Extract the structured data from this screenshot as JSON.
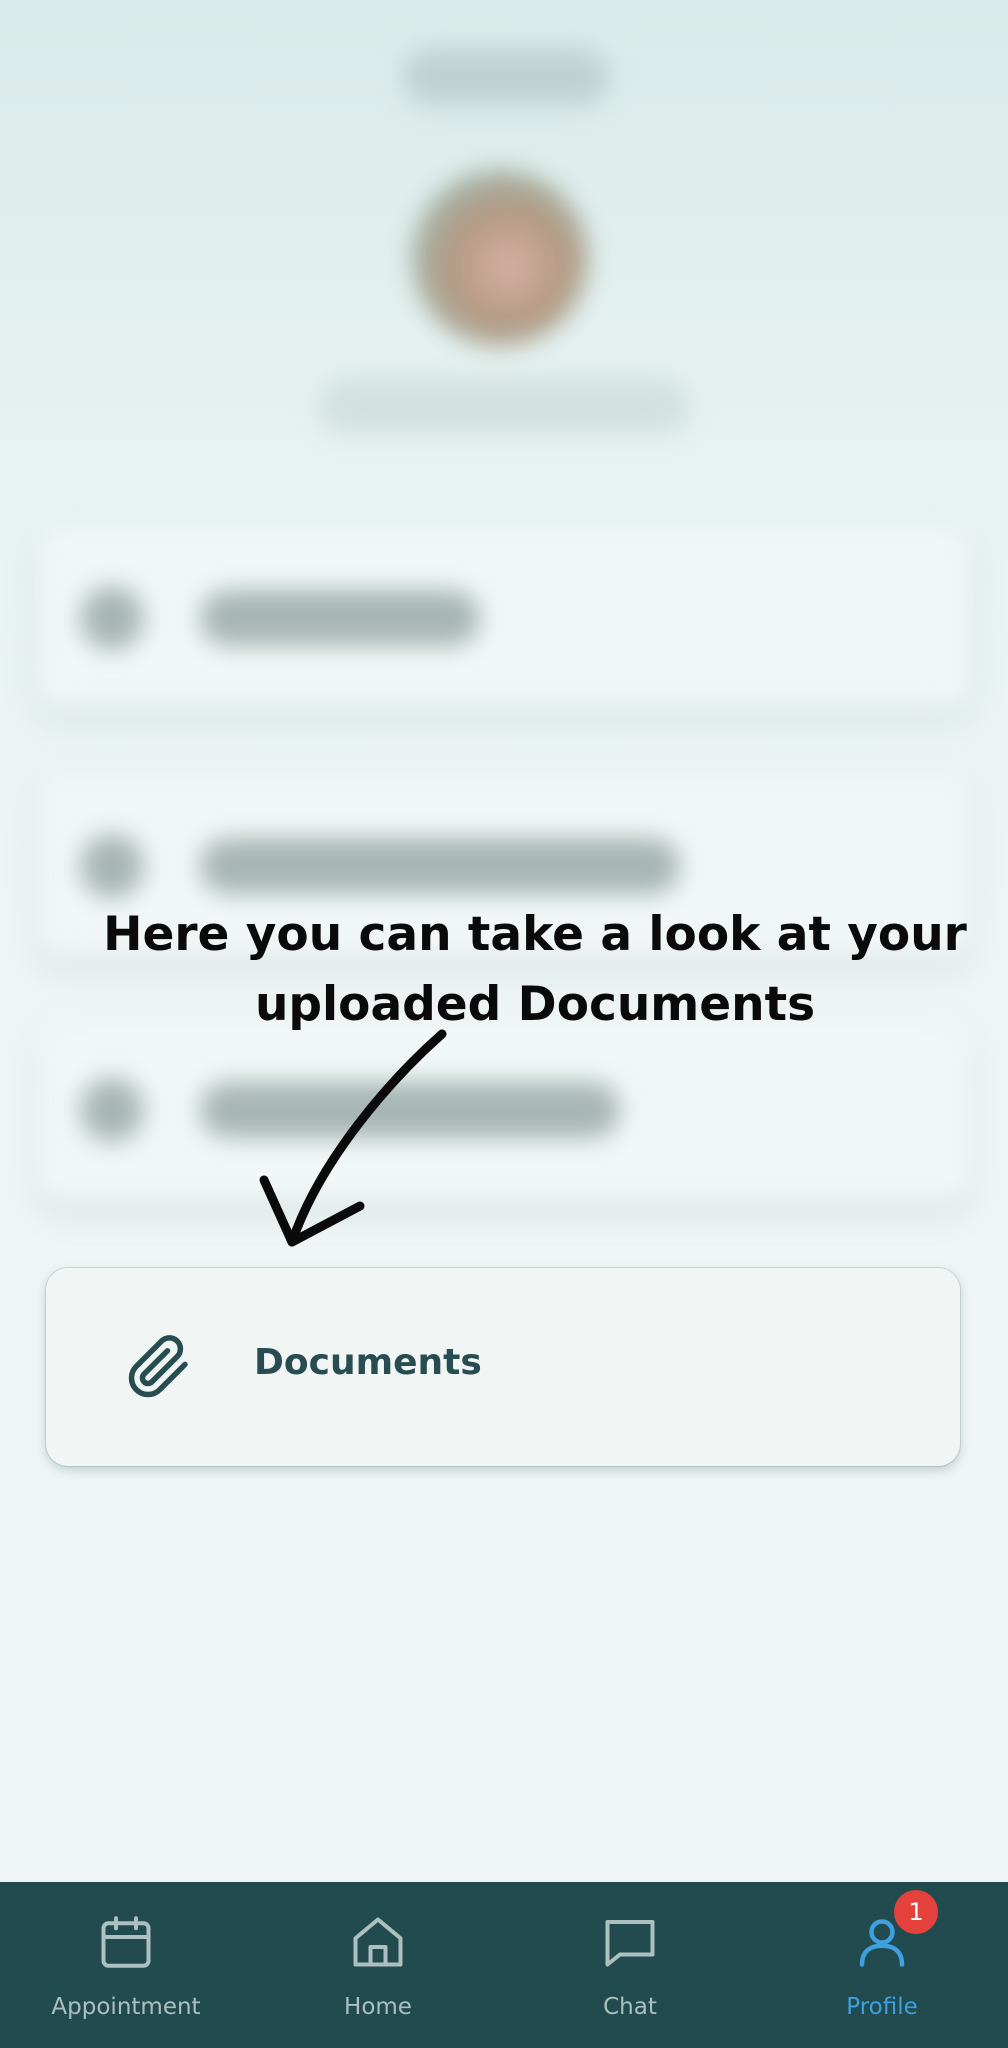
{
  "annotation": {
    "line1": "Here you can take a look at your",
    "line2": "uploaded Documents"
  },
  "documents_item": {
    "label": "Documents",
    "icon": "paperclip-icon"
  },
  "bottom_nav": {
    "items": [
      {
        "label": "Appointment",
        "icon": "calendar-icon",
        "active": false
      },
      {
        "label": "Home",
        "icon": "home-icon",
        "active": false
      },
      {
        "label": "Chat",
        "icon": "chat-icon",
        "active": false
      },
      {
        "label": "Profile",
        "icon": "profile-icon",
        "active": true,
        "badge": "1"
      }
    ]
  },
  "colors": {
    "nav_background": "#224b50",
    "active_accent": "#3ea0de",
    "inactive_nav": "#aebfbf",
    "badge": "#e5413d",
    "primary_text": "#284d51"
  }
}
